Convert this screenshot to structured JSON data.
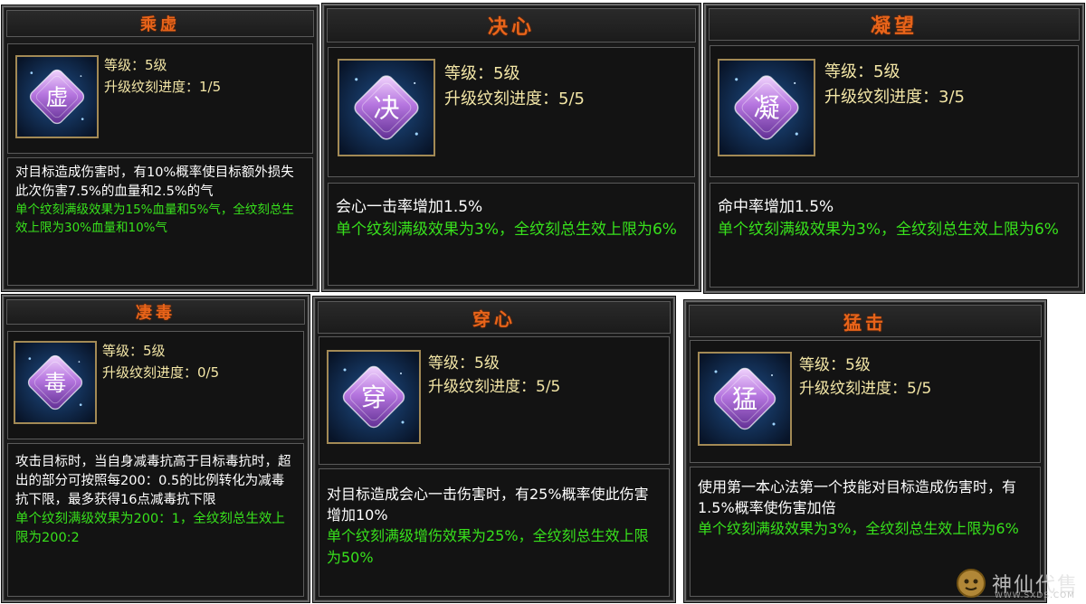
{
  "panels": [
    {
      "title": "乘虚",
      "icon_char": "虚",
      "level": "等级：5级",
      "progress": "升级纹刻进度：1/5",
      "desc_white": "对目标造成伤害时，有10%概率使目标额外损失此次伤害7.5%的血量和2.5%的气",
      "desc_green": "单个纹刻满级效果为15%血量和5%气，全纹刻总生效上限为30%血量和10%气"
    },
    {
      "title": "决心",
      "icon_char": "决",
      "level": "等级：5级",
      "progress": "升级纹刻进度：5/5",
      "desc_white": "会心一击率增加1.5%",
      "desc_green": "单个纹刻满级效果为3%，全纹刻总生效上限为6%"
    },
    {
      "title": "凝望",
      "icon_char": "凝",
      "level": "等级：5级",
      "progress": "升级纹刻进度：3/5",
      "desc_white": "命中率增加1.5%",
      "desc_green": "单个纹刻满级效果为3%，全纹刻总生效上限为6%"
    },
    {
      "title": "凄毒",
      "icon_char": "毒",
      "level": "等级：5级",
      "progress": "升级纹刻进度：0/5",
      "desc_white": "攻击目标时，当自身减毒抗高于目标毒抗时，超出的部分可按照每200：0.5的比例转化为减毒抗下限，最多获得16点减毒抗下限",
      "desc_green": "单个纹刻满级效果为200：1，全纹刻总生效上限为200:2"
    },
    {
      "title": "穿心",
      "icon_char": "穿",
      "level": "等级：5级",
      "progress": "升级纹刻进度：5/5",
      "desc_white": "对目标造成会心一击伤害时，有25%概率使此伤害增加10%",
      "desc_green": "单个纹刻满级增伤效果为25%，全纹刻总生效上限为50%"
    },
    {
      "title": "猛击",
      "icon_char": "猛",
      "level": "等级：5级",
      "progress": "升级纹刻进度：5/5",
      "desc_white": "使用第一本心法第一个技能对目标造成伤害时，有1.5%概率使伤害加倍",
      "desc_green": "单个纹刻满级效果为3%，全纹刻总生效上限为6%"
    }
  ],
  "watermark": {
    "text": "神仙代售",
    "url": "WWW.SXDS.COM"
  },
  "colors": {
    "title": "#e8641a",
    "stat": "#f3e6a6",
    "desc": "#ffffff",
    "effect": "#38e21c",
    "panel_bg": "#1a1a1a"
  }
}
